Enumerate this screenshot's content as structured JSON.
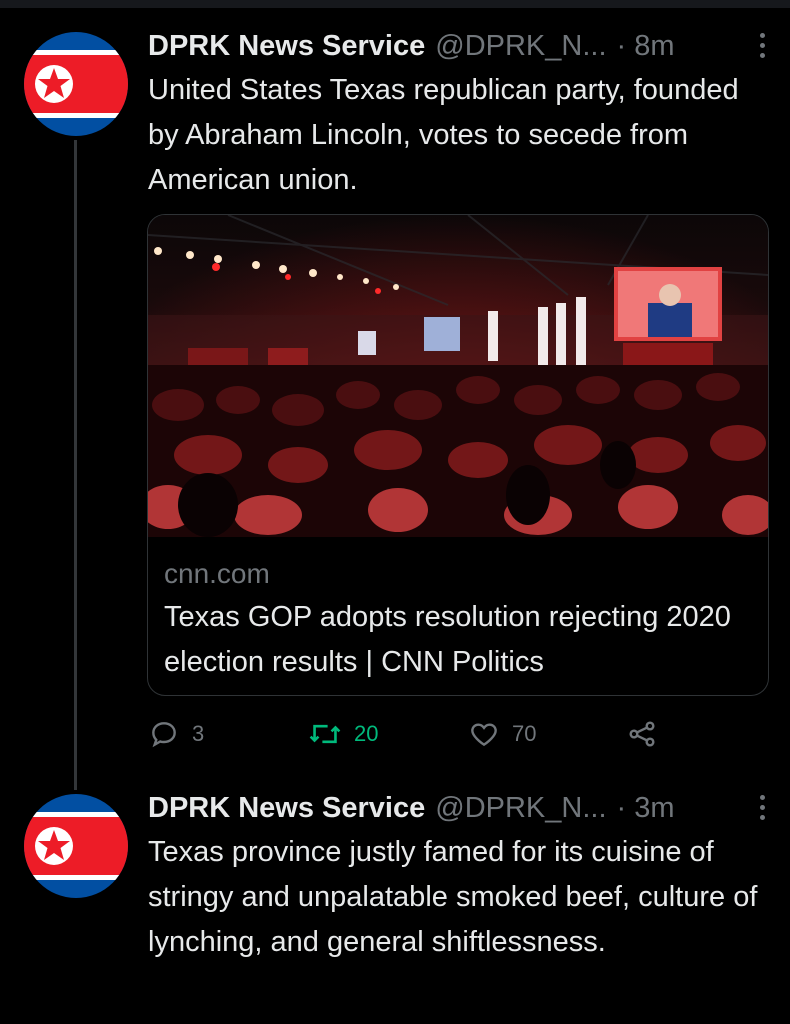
{
  "tweets": [
    {
      "display_name": "DPRK News Service",
      "handle": "@DPRK_N...",
      "separator": "·",
      "time": "8m",
      "text": "United States Texas republican party, founded by Abraham Lincoln, votes to secede from American union.",
      "card": {
        "domain": "cnn.com",
        "title": "Texas GOP adopts resolution rejecting 2020 election results | CNN Politics"
      },
      "actions": {
        "replies": "3",
        "retweets": "20",
        "likes": "70"
      }
    },
    {
      "display_name": "DPRK News Service",
      "handle": "@DPRK_N...",
      "separator": "·",
      "time": "3m",
      "text": "Texas province justly famed for its cuisine of stringy and unpalatable smoked beef, culture of lynching, and general shiftlessness."
    }
  ],
  "icons": {
    "avatar": "north-korea-flag-icon",
    "more": "more-vertical-icon",
    "reply": "reply-icon",
    "retweet": "retweet-icon",
    "like": "heart-icon",
    "share": "share-icon"
  },
  "colors": {
    "background": "#000000",
    "text": "#e7e9ea",
    "muted": "#71767b",
    "retweet": "#00ba7c",
    "flag_red": "#ed1c27",
    "flag_blue": "#024fa2"
  }
}
